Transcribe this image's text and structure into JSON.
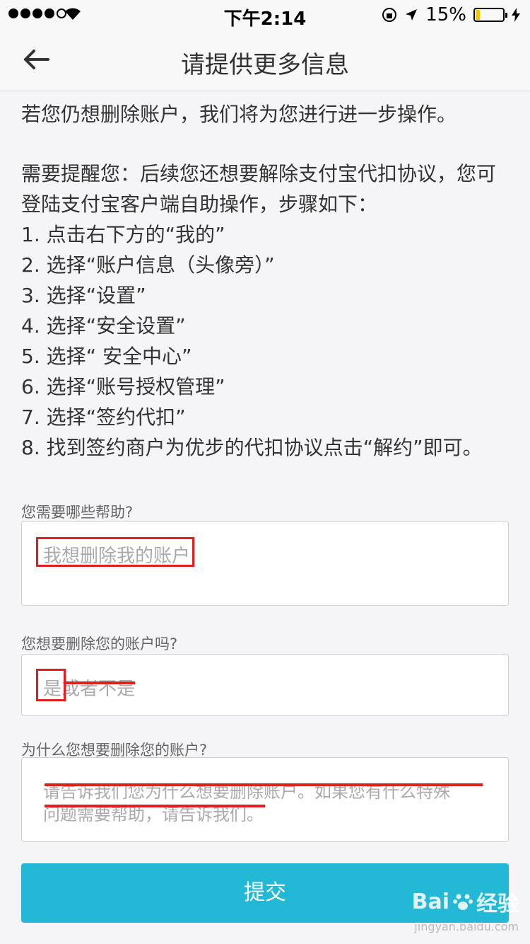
{
  "status_bar": {
    "time": "下午2:14",
    "battery": "15%",
    "battery_level": 0.15
  },
  "nav": {
    "title": "请提供更多信息"
  },
  "body": {
    "intro": "若您仍想删除账户，我们将为您进行进一步操作。",
    "reminder_line1": "需要提醒您：后续您还想要解除支付宝代扣协议，您可",
    "reminder_line2": "登陆支付宝客户端自助操作，步骤如下：",
    "steps": [
      "1. 点击右下方的“我的”",
      "2. 选择“账户信息（头像旁）”",
      "3. 选择“设置”",
      "4. 选择“安全设置”",
      "5. 选择“ 安全中心”",
      "6. 选择“账号授权管理”",
      "7. 选择“签约代扣”",
      "8. 找到签约商户为优步的代扣协议点击“解约”即可。"
    ]
  },
  "form": {
    "help_label": "您需要哪些帮助?",
    "help_value": "我想删除我的账户",
    "delete_label": "您想要删除您的账户吗?",
    "delete_yes": "是",
    "delete_rest": "或者不是",
    "reason_label": "为什么您想要删除您的账户?",
    "reason_line1": "请告诉我们您为什么想要删除账户。如果您有什么特殊",
    "reason_line2": "问题需要帮助，请告诉我们。"
  },
  "submit_label": "提交",
  "watermark": {
    "brand": "Bai",
    "brand2": "经验",
    "url": "jingyan.baidu.com"
  },
  "colors": {
    "accent": "#22b8d6",
    "annotation": "#e02020"
  }
}
